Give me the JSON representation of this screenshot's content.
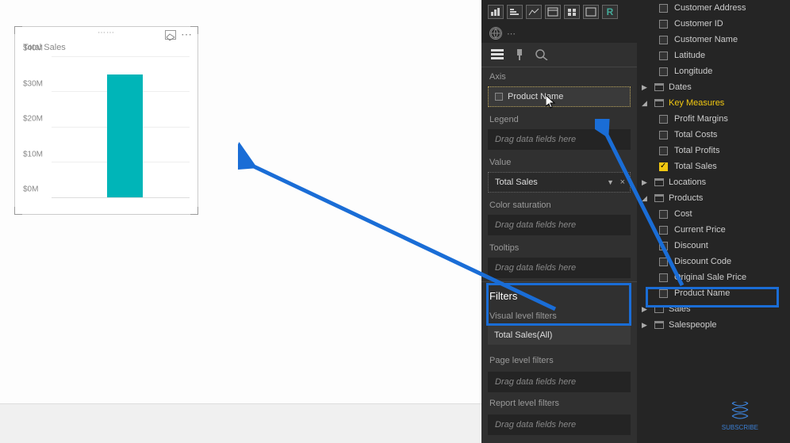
{
  "chart": {
    "title": "Total Sales",
    "chart_data": {
      "type": "bar",
      "categories": [
        ""
      ],
      "values": [
        35000000
      ],
      "ylabel": "",
      "ylim": [
        0,
        40000000
      ],
      "y_ticks": [
        "$0M",
        "$10M",
        "$20M",
        "$30M",
        "$40M"
      ]
    }
  },
  "viz_panel": {
    "tabs": [
      "fields",
      "format",
      "analytics"
    ],
    "sections": {
      "axis": {
        "label": "Axis",
        "value": "Product Name",
        "filled": true
      },
      "legend": {
        "label": "Legend",
        "placeholder": "Drag data fields here"
      },
      "value": {
        "label": "Value",
        "value": "Total Sales",
        "filled": true
      },
      "color_sat": {
        "label": "Color saturation",
        "placeholder": "Drag data fields here"
      },
      "tooltips": {
        "label": "Tooltips",
        "placeholder": "Drag data fields here"
      }
    },
    "filters": {
      "header": "Filters",
      "visual": {
        "label": "Visual level filters",
        "item": "Total Sales(All)"
      },
      "page": {
        "label": "Page level filters",
        "placeholder": "Drag data fields here"
      },
      "report": {
        "label": "Report level filters",
        "placeholder": "Drag data fields here"
      }
    }
  },
  "fields_panel": {
    "top_fields": [
      {
        "name": "Customer Address"
      },
      {
        "name": "Customer ID"
      },
      {
        "name": "Customer Name"
      },
      {
        "name": "Latitude"
      },
      {
        "name": "Longitude"
      }
    ],
    "tables": [
      {
        "name": "Dates",
        "expanded": false,
        "key": false
      },
      {
        "name": "Key Measures",
        "expanded": true,
        "key": true,
        "fields": [
          {
            "name": "Profit Margins",
            "checked": false
          },
          {
            "name": "Total Costs",
            "checked": false
          },
          {
            "name": "Total Profits",
            "checked": false
          },
          {
            "name": "Total Sales",
            "checked": true
          }
        ]
      },
      {
        "name": "Locations",
        "expanded": false,
        "key": false
      },
      {
        "name": "Products",
        "expanded": true,
        "key": false,
        "fields": [
          {
            "name": "Cost",
            "checked": false
          },
          {
            "name": "Current Price",
            "checked": false
          },
          {
            "name": "Discount",
            "checked": false
          },
          {
            "name": "Discount Code",
            "checked": false
          },
          {
            "name": "Original Sale Price",
            "checked": false
          },
          {
            "name": "Product Name",
            "checked": false,
            "highlighted": true
          }
        ]
      },
      {
        "name": "Sales",
        "expanded": false,
        "key": false
      },
      {
        "name": "Salespeople",
        "expanded": false,
        "key": false
      }
    ]
  },
  "subscribe_label": "SUBSCRIBE"
}
